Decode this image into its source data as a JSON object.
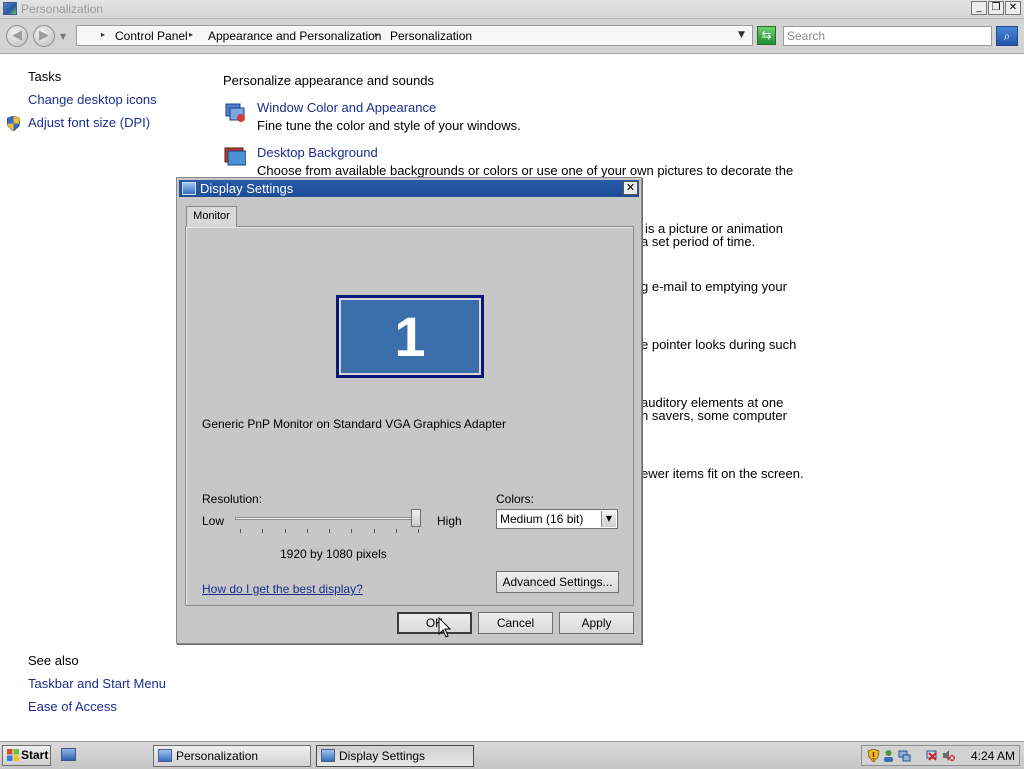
{
  "window": {
    "title": "Personalization",
    "controls": {
      "minimize": "_",
      "restore": "❐",
      "close": "✕"
    }
  },
  "address_bar": {
    "back_icon": "back-arrow",
    "forward_icon": "forward-arrow",
    "breadcrumbs": [
      "Control Panel",
      "Appearance and Personalization",
      "Personalization"
    ],
    "search_placeholder": "Search"
  },
  "tasks": {
    "heading": "Tasks",
    "links": [
      "Change desktop icons",
      "Adjust font size (DPI)"
    ]
  },
  "see_also": {
    "heading": "See also",
    "links": [
      "Taskbar and Start Menu",
      "Ease of Access"
    ]
  },
  "content": {
    "heading": "Personalize appearance and sounds",
    "items": [
      {
        "title": "Window Color and Appearance",
        "desc": "Fine tune the color and style of your windows."
      },
      {
        "title": "Desktop Background",
        "desc": "Choose from available backgrounds or colors or use one of your own pictures to decorate the"
      }
    ],
    "obscured_fragments": [
      "r is a picture or animation",
      "a set period of time.",
      "g e-mail to emptying your",
      "e pointer looks during such",
      "auditory elements at one",
      "n savers, some computer",
      "ewer items fit on the screen."
    ]
  },
  "dialog": {
    "title": "Display Settings",
    "tab": "Monitor",
    "monitor_number": "1",
    "monitor_description": "Generic PnP Monitor on Standard VGA Graphics Adapter",
    "resolution": {
      "label": "Resolution:",
      "low": "Low",
      "high": "High",
      "value_text": "1920 by 1080 pixels",
      "slider_level": 1.0
    },
    "colors": {
      "label": "Colors:",
      "selected": "Medium (16 bit)"
    },
    "help_link": "How do I get the best display?",
    "advanced_button": "Advanced Settings...",
    "ok_button": "OK",
    "cancel_button": "Cancel",
    "apply_button": "Apply"
  },
  "taskbar": {
    "start_label": "Start",
    "tasks": [
      "Personalization",
      "Display Settings"
    ],
    "active_task": "Display Settings",
    "clock": "4:24 AM"
  }
}
